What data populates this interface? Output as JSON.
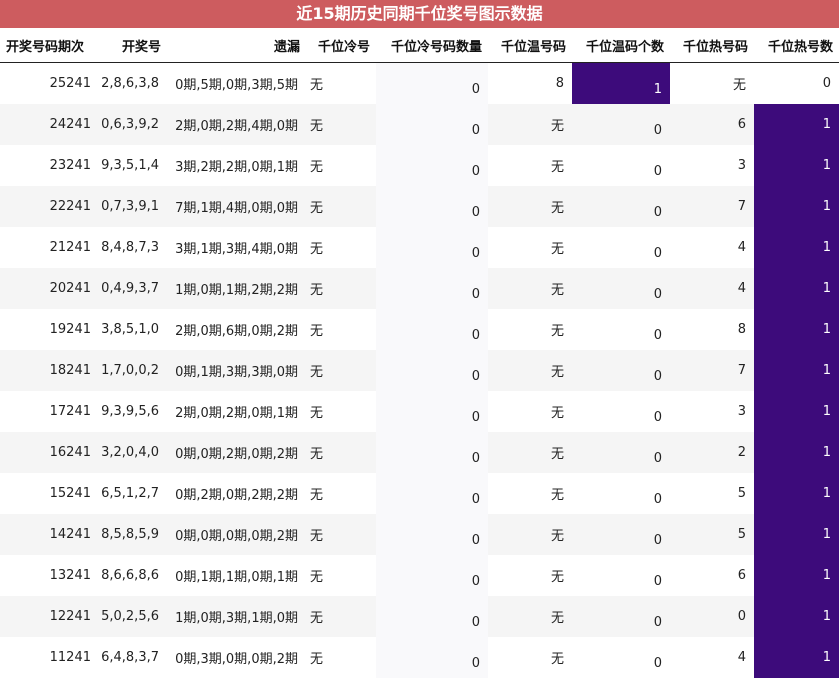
{
  "title": "近15期历史同期千位奖号图示数据",
  "headers": [
    "开奖号码期次",
    "开奖号",
    "遗漏",
    "千位冷号",
    "千位冷号码数量",
    "千位温号码",
    "千位温码个数",
    "千位热号码",
    "千位热号数"
  ],
  "rows": [
    [
      "25241",
      "2,8,6,3,8",
      "0期,5期,0期,3期,5期",
      "无",
      "0",
      "8",
      "1",
      "无",
      "0"
    ],
    [
      "24241",
      "0,6,3,9,2",
      "2期,0期,2期,4期,0期",
      "无",
      "0",
      "无",
      "0",
      "6",
      "1"
    ],
    [
      "23241",
      "9,3,5,1,4",
      "3期,2期,2期,0期,1期",
      "无",
      "0",
      "无",
      "0",
      "3",
      "1"
    ],
    [
      "22241",
      "0,7,3,9,1",
      "7期,1期,4期,0期,0期",
      "无",
      "0",
      "无",
      "0",
      "7",
      "1"
    ],
    [
      "21241",
      "8,4,8,7,3",
      "3期,1期,3期,4期,0期",
      "无",
      "0",
      "无",
      "0",
      "4",
      "1"
    ],
    [
      "20241",
      "0,4,9,3,7",
      "1期,0期,1期,2期,2期",
      "无",
      "0",
      "无",
      "0",
      "4",
      "1"
    ],
    [
      "19241",
      "3,8,5,1,0",
      "2期,0期,6期,0期,2期",
      "无",
      "0",
      "无",
      "0",
      "8",
      "1"
    ],
    [
      "18241",
      "1,7,0,0,2",
      "0期,1期,3期,3期,0期",
      "无",
      "0",
      "无",
      "0",
      "7",
      "1"
    ],
    [
      "17241",
      "9,3,9,5,6",
      "2期,0期,2期,0期,1期",
      "无",
      "0",
      "无",
      "0",
      "3",
      "1"
    ],
    [
      "16241",
      "3,2,0,4,0",
      "0期,0期,2期,0期,2期",
      "无",
      "0",
      "无",
      "0",
      "2",
      "1"
    ],
    [
      "15241",
      "6,5,1,2,7",
      "0期,2期,0期,2期,2期",
      "无",
      "0",
      "无",
      "0",
      "5",
      "1"
    ],
    [
      "14241",
      "8,5,8,5,9",
      "0期,0期,0期,0期,2期",
      "无",
      "0",
      "无",
      "0",
      "5",
      "1"
    ],
    [
      "13241",
      "8,6,6,8,6",
      "0期,1期,1期,0期,1期",
      "无",
      "0",
      "无",
      "0",
      "6",
      "1"
    ],
    [
      "12241",
      "5,0,2,5,6",
      "1期,0期,3期,1期,0期",
      "无",
      "0",
      "无",
      "0",
      "0",
      "1"
    ],
    [
      "11241",
      "6,4,8,3,7",
      "0期,3期,0期,0期,2期",
      "无",
      "0",
      "无",
      "0",
      "4",
      "1"
    ]
  ]
}
